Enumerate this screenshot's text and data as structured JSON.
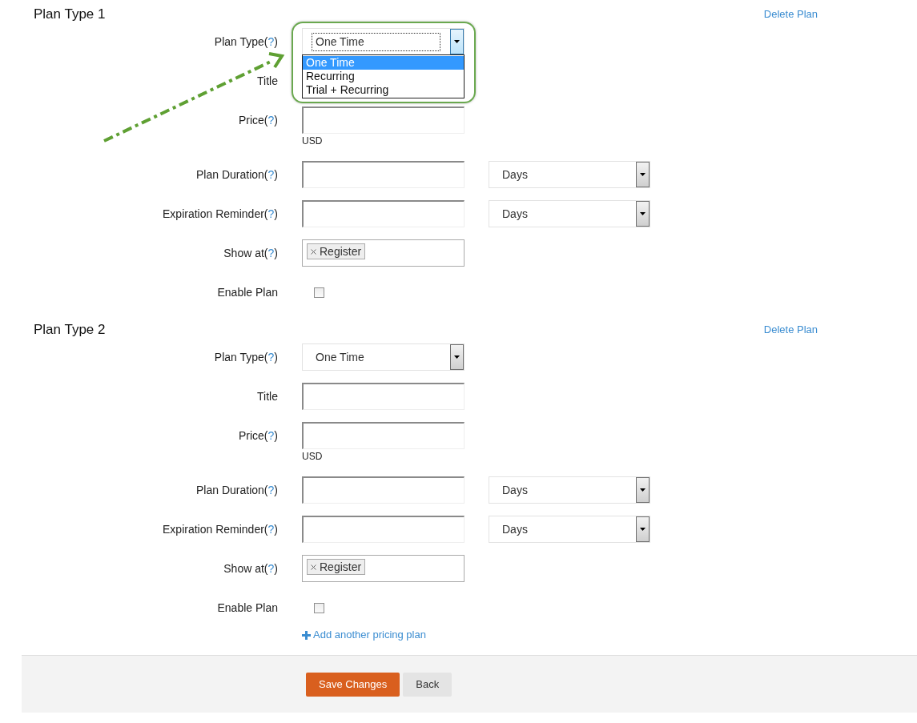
{
  "plans": [
    {
      "title": "Plan Type 1",
      "delete_link": "Delete Plan",
      "fields": [
        {
          "kind": "select",
          "label": "Plan Type",
          "help": "(?)",
          "value": "One Time",
          "focused": true,
          "options": [
            {
              "label": "One Time",
              "selected": true
            },
            {
              "label": "Recurring",
              "selected": false
            },
            {
              "label": "Trial + Recurring",
              "selected": false
            }
          ]
        },
        {
          "kind": "text",
          "label": "Title"
        },
        {
          "kind": "text",
          "label": "Price",
          "help": "(?)",
          "unit": "USD"
        },
        {
          "kind": "duration",
          "label": "Plan Duration",
          "help": "(?)",
          "unit_select": "Days"
        },
        {
          "kind": "duration",
          "label": "Expiration Reminder",
          "help": "(?)",
          "unit_select": "Days"
        },
        {
          "kind": "tags",
          "label": "Show at",
          "help": "(?)",
          "tags": [
            "Register"
          ]
        },
        {
          "kind": "checkbox",
          "label": "Enable Plan",
          "checked": false
        }
      ]
    },
    {
      "title": "Plan Type 2",
      "delete_link": "Delete Plan",
      "fields": [
        {
          "kind": "select",
          "label": "Plan Type",
          "help": "(?)",
          "value": "One Time",
          "focused": false
        },
        {
          "kind": "text",
          "label": "Title"
        },
        {
          "kind": "text",
          "label": "Price",
          "help": "(?)",
          "unit": "USD"
        },
        {
          "kind": "duration",
          "label": "Plan Duration",
          "help": "(?)",
          "unit_select": "Days"
        },
        {
          "kind": "duration",
          "label": "Expiration Reminder",
          "help": "(?)",
          "unit_select": "Days"
        },
        {
          "kind": "tags",
          "label": "Show at",
          "help": "(?)",
          "tags": [
            "Register"
          ]
        },
        {
          "kind": "checkbox",
          "label": "Enable Plan",
          "checked": false
        }
      ]
    }
  ],
  "add_link": "Add another pricing plan",
  "buttons": [
    {
      "label": "Save Changes",
      "kind": "primary"
    },
    {
      "label": "Back",
      "kind": "secondary"
    }
  ],
  "annotation": {
    "arrow": true,
    "highlight": true
  }
}
